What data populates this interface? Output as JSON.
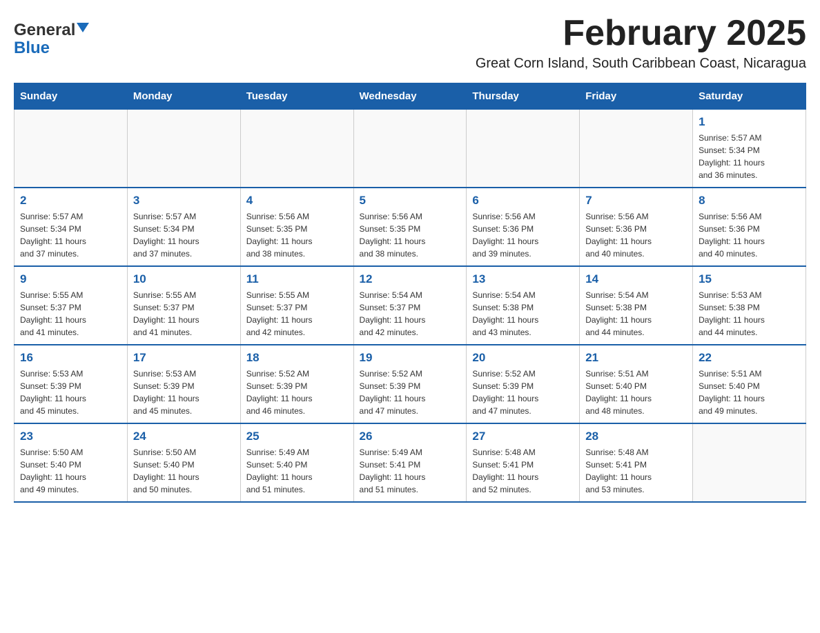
{
  "header": {
    "logo": {
      "general": "General",
      "blue": "Blue",
      "arrow": "▼"
    },
    "title": "February 2025",
    "location": "Great Corn Island, South Caribbean Coast, Nicaragua"
  },
  "days_of_week": [
    "Sunday",
    "Monday",
    "Tuesday",
    "Wednesday",
    "Thursday",
    "Friday",
    "Saturday"
  ],
  "weeks": [
    [
      {
        "day": "",
        "info": ""
      },
      {
        "day": "",
        "info": ""
      },
      {
        "day": "",
        "info": ""
      },
      {
        "day": "",
        "info": ""
      },
      {
        "day": "",
        "info": ""
      },
      {
        "day": "",
        "info": ""
      },
      {
        "day": "1",
        "info": "Sunrise: 5:57 AM\nSunset: 5:34 PM\nDaylight: 11 hours\nand 36 minutes."
      }
    ],
    [
      {
        "day": "2",
        "info": "Sunrise: 5:57 AM\nSunset: 5:34 PM\nDaylight: 11 hours\nand 37 minutes."
      },
      {
        "day": "3",
        "info": "Sunrise: 5:57 AM\nSunset: 5:34 PM\nDaylight: 11 hours\nand 37 minutes."
      },
      {
        "day": "4",
        "info": "Sunrise: 5:56 AM\nSunset: 5:35 PM\nDaylight: 11 hours\nand 38 minutes."
      },
      {
        "day": "5",
        "info": "Sunrise: 5:56 AM\nSunset: 5:35 PM\nDaylight: 11 hours\nand 38 minutes."
      },
      {
        "day": "6",
        "info": "Sunrise: 5:56 AM\nSunset: 5:36 PM\nDaylight: 11 hours\nand 39 minutes."
      },
      {
        "day": "7",
        "info": "Sunrise: 5:56 AM\nSunset: 5:36 PM\nDaylight: 11 hours\nand 40 minutes."
      },
      {
        "day": "8",
        "info": "Sunrise: 5:56 AM\nSunset: 5:36 PM\nDaylight: 11 hours\nand 40 minutes."
      }
    ],
    [
      {
        "day": "9",
        "info": "Sunrise: 5:55 AM\nSunset: 5:37 PM\nDaylight: 11 hours\nand 41 minutes."
      },
      {
        "day": "10",
        "info": "Sunrise: 5:55 AM\nSunset: 5:37 PM\nDaylight: 11 hours\nand 41 minutes."
      },
      {
        "day": "11",
        "info": "Sunrise: 5:55 AM\nSunset: 5:37 PM\nDaylight: 11 hours\nand 42 minutes."
      },
      {
        "day": "12",
        "info": "Sunrise: 5:54 AM\nSunset: 5:37 PM\nDaylight: 11 hours\nand 42 minutes."
      },
      {
        "day": "13",
        "info": "Sunrise: 5:54 AM\nSunset: 5:38 PM\nDaylight: 11 hours\nand 43 minutes."
      },
      {
        "day": "14",
        "info": "Sunrise: 5:54 AM\nSunset: 5:38 PM\nDaylight: 11 hours\nand 44 minutes."
      },
      {
        "day": "15",
        "info": "Sunrise: 5:53 AM\nSunset: 5:38 PM\nDaylight: 11 hours\nand 44 minutes."
      }
    ],
    [
      {
        "day": "16",
        "info": "Sunrise: 5:53 AM\nSunset: 5:39 PM\nDaylight: 11 hours\nand 45 minutes."
      },
      {
        "day": "17",
        "info": "Sunrise: 5:53 AM\nSunset: 5:39 PM\nDaylight: 11 hours\nand 45 minutes."
      },
      {
        "day": "18",
        "info": "Sunrise: 5:52 AM\nSunset: 5:39 PM\nDaylight: 11 hours\nand 46 minutes."
      },
      {
        "day": "19",
        "info": "Sunrise: 5:52 AM\nSunset: 5:39 PM\nDaylight: 11 hours\nand 47 minutes."
      },
      {
        "day": "20",
        "info": "Sunrise: 5:52 AM\nSunset: 5:39 PM\nDaylight: 11 hours\nand 47 minutes."
      },
      {
        "day": "21",
        "info": "Sunrise: 5:51 AM\nSunset: 5:40 PM\nDaylight: 11 hours\nand 48 minutes."
      },
      {
        "day": "22",
        "info": "Sunrise: 5:51 AM\nSunset: 5:40 PM\nDaylight: 11 hours\nand 49 minutes."
      }
    ],
    [
      {
        "day": "23",
        "info": "Sunrise: 5:50 AM\nSunset: 5:40 PM\nDaylight: 11 hours\nand 49 minutes."
      },
      {
        "day": "24",
        "info": "Sunrise: 5:50 AM\nSunset: 5:40 PM\nDaylight: 11 hours\nand 50 minutes."
      },
      {
        "day": "25",
        "info": "Sunrise: 5:49 AM\nSunset: 5:40 PM\nDaylight: 11 hours\nand 51 minutes."
      },
      {
        "day": "26",
        "info": "Sunrise: 5:49 AM\nSunset: 5:41 PM\nDaylight: 11 hours\nand 51 minutes."
      },
      {
        "day": "27",
        "info": "Sunrise: 5:48 AM\nSunset: 5:41 PM\nDaylight: 11 hours\nand 52 minutes."
      },
      {
        "day": "28",
        "info": "Sunrise: 5:48 AM\nSunset: 5:41 PM\nDaylight: 11 hours\nand 53 minutes."
      },
      {
        "day": "",
        "info": ""
      }
    ]
  ]
}
